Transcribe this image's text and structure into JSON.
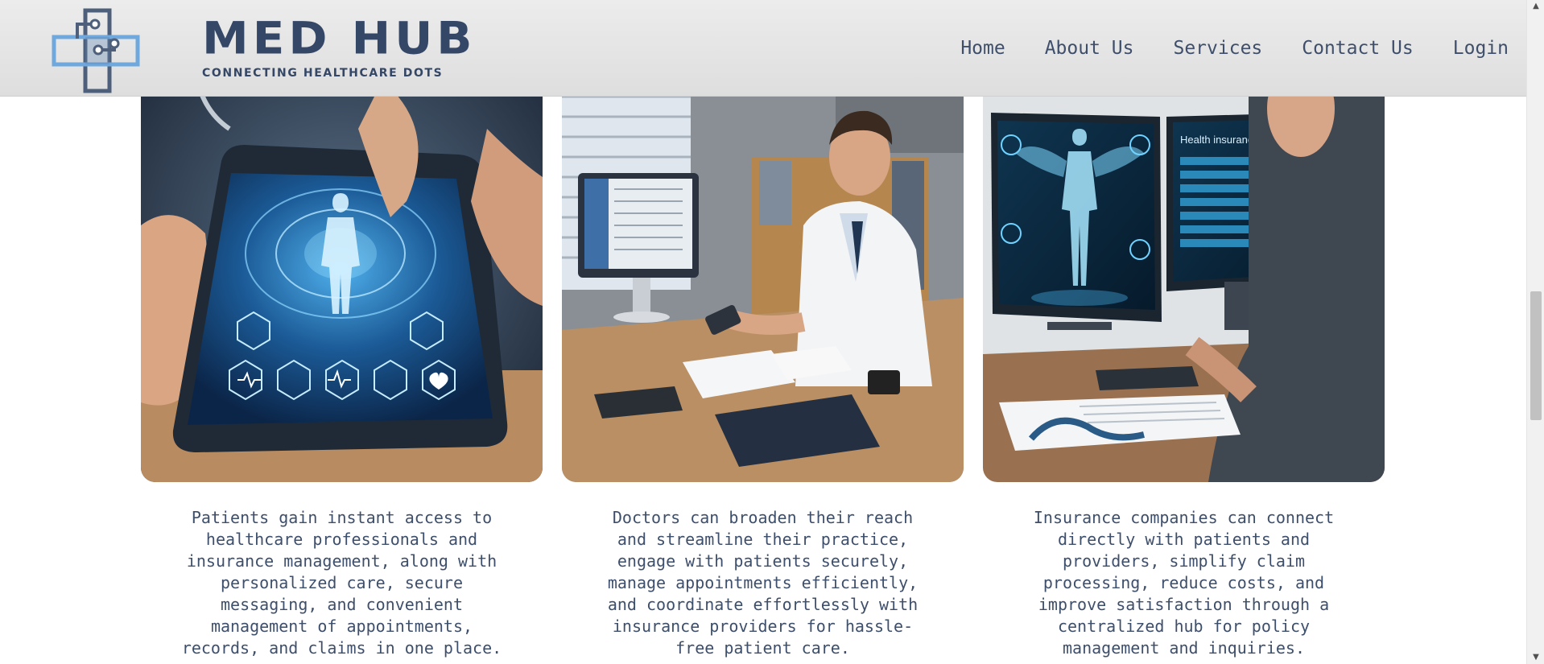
{
  "brand": {
    "name": "MED HUB",
    "tagline": "CONNECTING HEALTHCARE DOTS",
    "logo_colors": {
      "light": "#6fa8dc",
      "dark": "#4d5f7a"
    }
  },
  "nav": {
    "items": [
      {
        "label": "Home"
      },
      {
        "label": "About Us"
      },
      {
        "label": "Services"
      },
      {
        "label": "Contact Us"
      },
      {
        "label": "Login"
      }
    ]
  },
  "cards": [
    {
      "image": "patient-tablet-illustration",
      "text": "Patients gain instant access to\nhealthcare professionals and\ninsurance management, along with\npersonalized care, secure\nmessaging, and convenient\nmanagement of appointments,\nrecords, and claims in one place."
    },
    {
      "image": "doctor-desk-illustration",
      "text": "Doctors can broaden their reach\nand streamline their practice,\nengage with patients securely,\nmanage appointments efficiently,\nand coordinate effortlessly with\ninsurance providers for hassle-\nfree patient care."
    },
    {
      "image": "insurance-monitor-illustration",
      "monitor_title": "Health insurance",
      "text": "Insurance companies can connect\ndirectly with patients and\nproviders, simplify claim\nprocessing, reduce costs, and\nimprove satisfaction through a\ncentralized hub for policy\nmanagement and inquiries."
    }
  ],
  "colors": {
    "text": "#3e4f6c",
    "header_bg": "#e4e4e4"
  }
}
